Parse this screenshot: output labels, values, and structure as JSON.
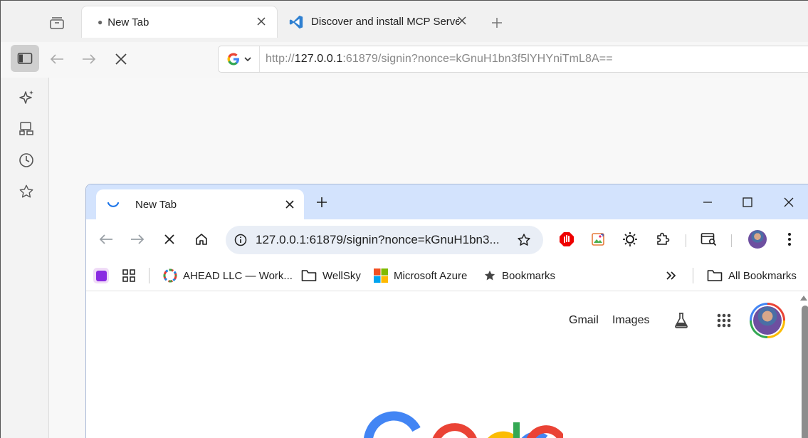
{
  "outer_browser": {
    "tabs": [
      {
        "title": "New Tab",
        "active": true
      },
      {
        "title": "Discover and install MCP Server",
        "active": false
      }
    ],
    "address": {
      "scheme": "http://",
      "host": "127.0.0.1",
      "rest": ":61879/signin?nonce=kGnuH1bn3f5lYHYniTmL8A=="
    },
    "sidebar_icons": [
      "sparkle-icon",
      "fleet-icon",
      "history-icon",
      "star-icon"
    ]
  },
  "inner_browser": {
    "tab": {
      "title": "New Tab"
    },
    "omnibox": {
      "url": "127.0.0.1:61879/signin?nonce=kGnuH1bn3..."
    },
    "bookmarks": [
      {
        "label": "AHEAD LLC — Work...",
        "icon": "ahead-icon"
      },
      {
        "label": "WellSky",
        "icon": "folder-icon"
      },
      {
        "label": "Microsoft Azure",
        "icon": "microsoft-icon"
      },
      {
        "label": "Bookmarks",
        "icon": "star-icon"
      }
    ],
    "all_bookmarks_label": "All Bookmarks",
    "page": {
      "links": {
        "gmail": "Gmail",
        "images": "Images"
      }
    }
  },
  "colors": {
    "inner_tabstrip": "#d3e3fd",
    "omnibox_bg": "#e9eef6",
    "google_blue": "#4285f4",
    "google_red": "#ea4335",
    "google_yellow": "#fbbc04",
    "google_green": "#34a853"
  }
}
